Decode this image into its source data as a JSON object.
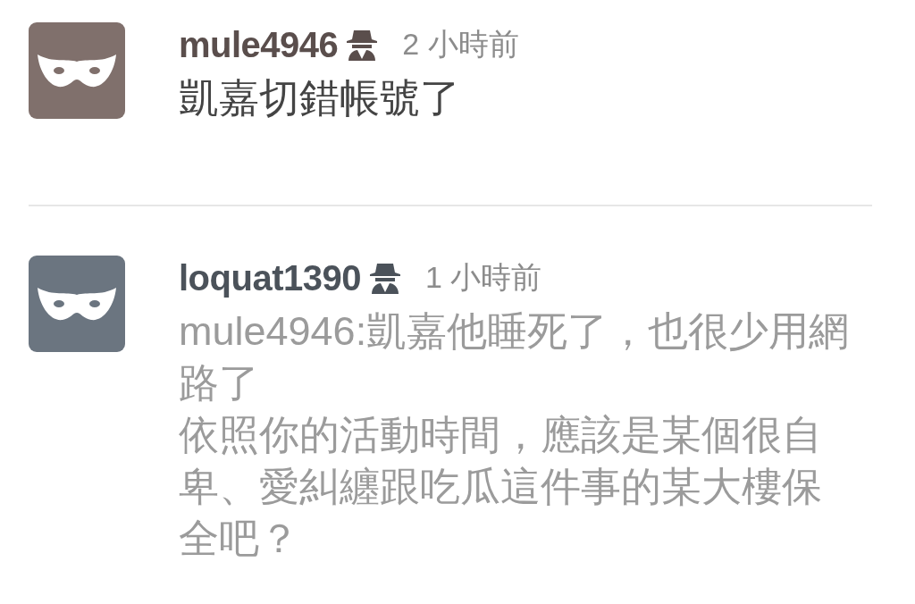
{
  "comments": [
    {
      "username": "mule4946",
      "time": "2 小時前",
      "color": "#80706c",
      "kind": "plain",
      "paragraphs": [
        "凱嘉切錯帳號了"
      ]
    },
    {
      "username": "loquat1390",
      "time": "1 小時前",
      "color": "#6b7580",
      "kind": "reply",
      "paragraphs": [
        "mule4946:凱嘉他睡死了，也很少用網路了",
        "依照你的活動時間，應該是某個很自卑、愛糾纏跟吃瓜這件事的某大樓保全吧？"
      ]
    }
  ]
}
